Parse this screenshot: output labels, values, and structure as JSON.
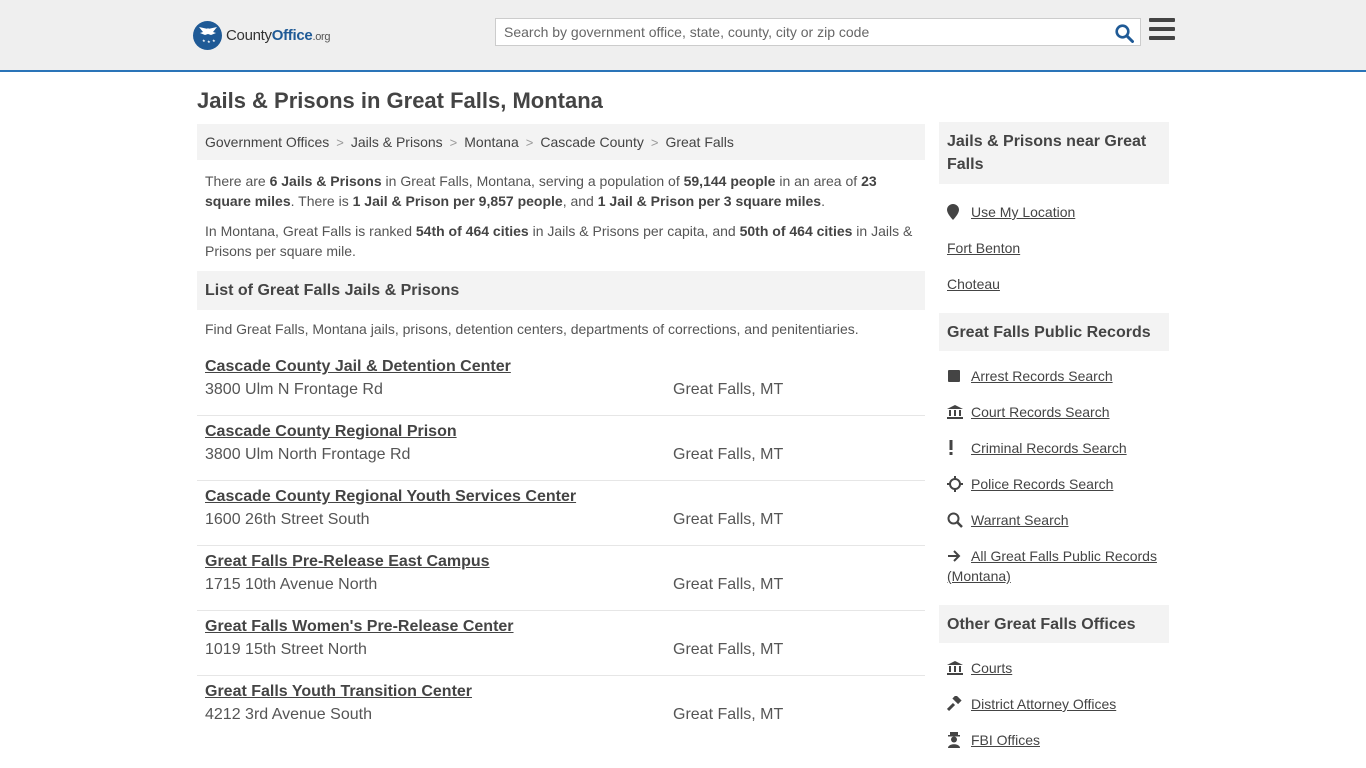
{
  "header": {
    "logo": {
      "county": "County",
      "office": "Office",
      "tld": ".org"
    },
    "search_placeholder": "Search by government office, state, county, city or zip code",
    "search_value": ""
  },
  "page_title": "Jails & Prisons in Great Falls, Montana",
  "breadcrumb": [
    "Government Offices",
    "Jails & Prisons",
    "Montana",
    "Cascade County",
    "Great Falls"
  ],
  "intro": {
    "p1": {
      "t1": "There are ",
      "b1": "6 Jails & Prisons",
      "t2": " in Great Falls, Montana, serving a population of ",
      "b2": "59,144 people",
      "t3": " in an area of ",
      "b3": "23 square miles",
      "t4": ". There is ",
      "b4": "1 Jail & Prison per 9,857 people",
      "t5": ", and ",
      "b5": "1 Jail & Prison per 3 square miles",
      "t6": "."
    },
    "p2": {
      "t1": "In Montana, Great Falls is ranked ",
      "b1": "54th of 464 cities",
      "t2": " in Jails & Prisons per capita, and ",
      "b2": "50th of 464 cities",
      "t3": " in Jails & Prisons per square mile."
    }
  },
  "list": {
    "heading": "List of Great Falls Jails & Prisons",
    "description": "Find Great Falls, Montana jails, prisons, detention centers, departments of corrections, and penitentiaries.",
    "entries": [
      {
        "name": "Cascade County Jail & Detention Center",
        "address": "3800 Ulm N Frontage Rd",
        "city": "Great Falls, MT"
      },
      {
        "name": "Cascade County Regional Prison",
        "address": "3800 Ulm North Frontage Rd",
        "city": "Great Falls, MT"
      },
      {
        "name": "Cascade County Regional Youth Services Center",
        "address": "1600 26th Street South",
        "city": "Great Falls, MT"
      },
      {
        "name": "Great Falls Pre-Release East Campus",
        "address": "1715 10th Avenue North",
        "city": "Great Falls, MT"
      },
      {
        "name": "Great Falls Women's Pre-Release Center",
        "address": "1019 15th Street North",
        "city": "Great Falls, MT"
      },
      {
        "name": "Great Falls Youth Transition Center",
        "address": "4212 3rd Avenue South",
        "city": "Great Falls, MT"
      }
    ]
  },
  "sidebar": {
    "near": {
      "heading": "Jails & Prisons near Great Falls",
      "use_location": "Use My Location",
      "items": [
        "Fort Benton",
        "Choteau"
      ]
    },
    "records": {
      "heading": "Great Falls Public Records",
      "items": [
        {
          "label": "Arrest Records Search",
          "icon": "square-icon"
        },
        {
          "label": "Court Records Search",
          "icon": "courthouse-icon"
        },
        {
          "label": "Criminal Records Search",
          "icon": "exclamation-icon"
        },
        {
          "label": "Police Records Search",
          "icon": "crosshair-icon"
        },
        {
          "label": "Warrant Search",
          "icon": "magnifier-icon"
        },
        {
          "label": "All Great Falls Public Records (Montana)",
          "icon": "arrow-right-icon"
        }
      ]
    },
    "offices": {
      "heading": "Other Great Falls Offices",
      "items": [
        {
          "label": "Courts",
          "icon": "courthouse-icon"
        },
        {
          "label": "District Attorney Offices",
          "icon": "gavel-icon"
        },
        {
          "label": "FBI Offices",
          "icon": "agent-icon"
        }
      ]
    }
  },
  "colors": {
    "accent": "#2a74b8",
    "logo": "#1f5a96",
    "header_bg": "#efefef",
    "panel_bg": "#f3f3f3"
  }
}
